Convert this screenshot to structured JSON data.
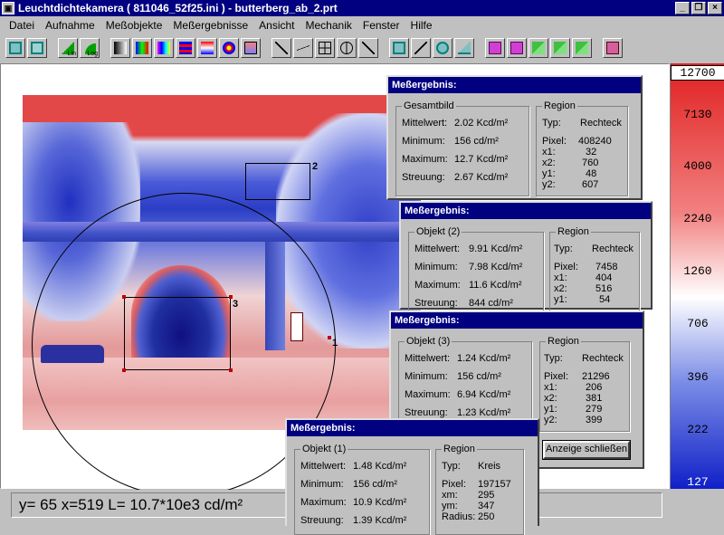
{
  "window": {
    "title": "Leuchtdichtekamera ( 811046_52f25.ini ) - butterberg_ab_2.prt"
  },
  "menu": [
    "Datei",
    "Aufnahme",
    "Meßobjekte",
    "Meßergebnisse",
    "Ansicht",
    "Mechanik",
    "Fenster",
    "Hilfe"
  ],
  "toolbar": {
    "lin_label": "Lin",
    "log_label": "Log"
  },
  "image_labels": {
    "circle": "1",
    "rect2": "2",
    "rect3": "3"
  },
  "scale": [
    "12700",
    "7130",
    "4000",
    "2240",
    "1260",
    "706",
    "396",
    "222",
    "127"
  ],
  "status": "y= 65 x=519 L= 10.7*10e3 cd/m²",
  "panels": [
    {
      "title": "Meßergebnis:",
      "group": "Gesamtbild",
      "rows": [
        [
          "Mittelwert:",
          "2.02 Kcd/m²"
        ],
        [
          "Minimum:",
          "156  cd/m²"
        ],
        [
          "Maximum:",
          "12.7 Kcd/m²"
        ],
        [
          "Streuung:",
          "2.67 Kcd/m²"
        ]
      ],
      "region": "Region",
      "type_label": "Typ:",
      "type_value": "Rechteck",
      "coords": [
        [
          "Pixel:",
          "408240"
        ],
        [
          "x1:",
          "32"
        ],
        [
          "x2:",
          "760"
        ],
        [
          "y1:",
          "48"
        ],
        [
          "y2:",
          "607"
        ]
      ]
    },
    {
      "title": "Meßergebnis:",
      "group": "Objekt (2)",
      "rows": [
        [
          "Mittelwert:",
          "9.91 Kcd/m²"
        ],
        [
          "Minimum:",
          "7.98 Kcd/m²"
        ],
        [
          "Maximum:",
          "11.6 Kcd/m²"
        ],
        [
          "Streuung:",
          "844  cd/m²"
        ]
      ],
      "region": "Region",
      "type_label": "Typ:",
      "type_value": "Rechteck",
      "coords": [
        [
          "Pixel:",
          "7458"
        ],
        [
          "x1:",
          "404"
        ],
        [
          "x2:",
          "516"
        ],
        [
          "y1:",
          "54"
        ]
      ]
    },
    {
      "title": "Meßergebnis:",
      "group": "Objekt (3)",
      "rows": [
        [
          "Mittelwert:",
          "1.24 Kcd/m²"
        ],
        [
          "Minimum:",
          "156  cd/m²"
        ],
        [
          "Maximum:",
          "6.94 Kcd/m²"
        ],
        [
          "Streuung:",
          "1.23 Kcd/m²"
        ]
      ],
      "region": "Region",
      "type_label": "Typ:",
      "type_value": "Rechteck",
      "coords": [
        [
          "Pixel:",
          "21296"
        ],
        [
          "x1:",
          "206"
        ],
        [
          "x2:",
          "381"
        ],
        [
          "y1:",
          "279"
        ],
        [
          "y2:",
          "399"
        ]
      ],
      "close_label": "Anzeige schließen"
    },
    {
      "title": "Meßergebnis:",
      "group": "Objekt (1)",
      "rows": [
        [
          "Mittelwert:",
          "1.48 Kcd/m²"
        ],
        [
          "Minimum:",
          "156  cd/m²"
        ],
        [
          "Maximum:",
          "10.9 Kcd/m²"
        ],
        [
          "Streuung:",
          "1.39 Kcd/m²"
        ]
      ],
      "region": "Region",
      "type_label": "Typ:",
      "type_value": "Kreis",
      "coords": [
        [
          "Pixel:",
          "197157"
        ],
        [
          "xm:",
          "295"
        ],
        [
          "ym:",
          "347"
        ],
        [
          "Radius:",
          "250"
        ]
      ]
    }
  ]
}
